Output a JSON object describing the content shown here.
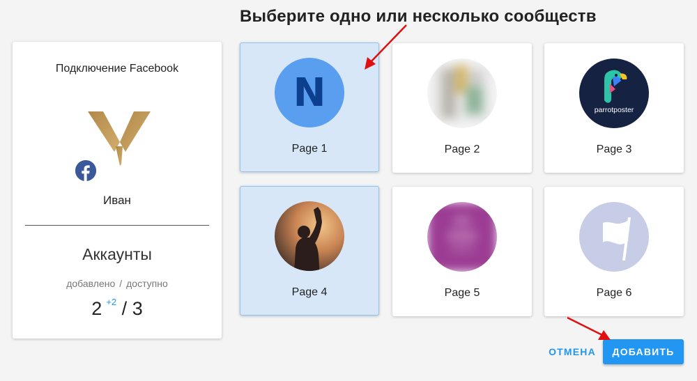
{
  "heading": "Выберите одно или несколько сообществ",
  "account": {
    "title": "Подключение Facebook",
    "user_name": "Иван",
    "accounts_heading": "Аккаунты",
    "added_label": "добавлено",
    "separator": "/",
    "available_label": "доступно",
    "count_added": "2",
    "count_new": "+2",
    "count_sep": "/",
    "count_total": "3"
  },
  "pages": [
    {
      "label": "Page 1",
      "selected": true,
      "avatar": "letter-n",
      "avatar_text": "N"
    },
    {
      "label": "Page 2",
      "selected": false,
      "avatar": "blurred-photo"
    },
    {
      "label": "Page 3",
      "selected": false,
      "avatar": "parrotposter-logo",
      "avatar_text": "parrotposter"
    },
    {
      "label": "Page 4",
      "selected": true,
      "avatar": "sunset-photo"
    },
    {
      "label": "Page 5",
      "selected": false,
      "avatar": "blurred-purple"
    },
    {
      "label": "Page 6",
      "selected": false,
      "avatar": "flag-icon"
    }
  ],
  "actions": {
    "cancel_label": "ОТМЕНА",
    "add_label": "ДОБАВИТЬ"
  },
  "colors": {
    "accent": "#2196f3",
    "selected_bg": "#d7e7f7",
    "facebook": "#3b5998",
    "annotation_arrow": "#e01010"
  }
}
